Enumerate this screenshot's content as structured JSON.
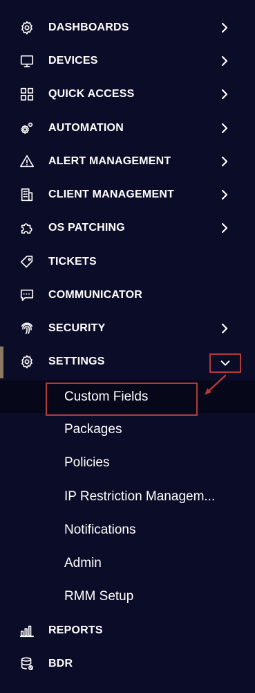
{
  "nav": {
    "items": [
      {
        "label": "DASHBOARDS",
        "icon": "gear-icon",
        "has_chevron": true
      },
      {
        "label": "DEVICES",
        "icon": "monitor-icon",
        "has_chevron": true
      },
      {
        "label": "QUICK ACCESS",
        "icon": "grid-icon",
        "has_chevron": true
      },
      {
        "label": "AUTOMATION",
        "icon": "gears-icon",
        "has_chevron": true
      },
      {
        "label": "ALERT MANAGEMENT",
        "icon": "warning-icon",
        "has_chevron": true
      },
      {
        "label": "CLIENT MANAGEMENT",
        "icon": "building-icon",
        "has_chevron": true
      },
      {
        "label": "OS PATCHING",
        "icon": "puzzle-icon",
        "has_chevron": true
      },
      {
        "label": "TICKETS",
        "icon": "tag-icon",
        "has_chevron": false
      },
      {
        "label": "COMMUNICATOR",
        "icon": "chat-icon",
        "has_chevron": false
      },
      {
        "label": "SECURITY",
        "icon": "fingerprint-icon",
        "has_chevron": true
      },
      {
        "label": "SETTINGS",
        "icon": "gear-icon",
        "expanded": true
      },
      {
        "label": "REPORTS",
        "icon": "bar-chart-icon",
        "has_chevron": false
      },
      {
        "label": "BDR",
        "icon": "database-icon",
        "has_chevron": false
      }
    ],
    "settings_submenu": [
      "Custom Fields",
      "Packages",
      "Policies",
      "IP Restriction Managem...",
      "Notifications",
      "Admin",
      "RMM Setup"
    ]
  },
  "colors": {
    "background": "#0b0c27",
    "text": "#ffffff",
    "annotation": "#b13a3a",
    "active_bar": "#8a7a63"
  }
}
